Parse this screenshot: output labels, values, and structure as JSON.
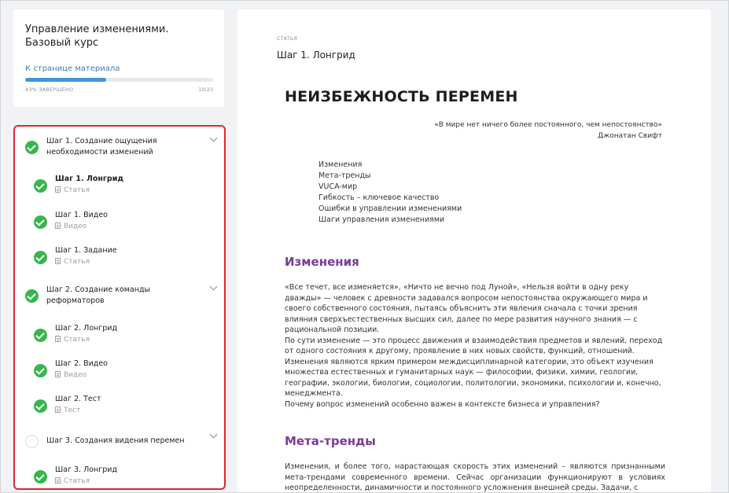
{
  "course": {
    "title": "Управление изменениями. Базовый курс",
    "link_label": "К странице материала",
    "progress_percent": 43,
    "progress_caption": "43% завершено",
    "progress_count": "10/23"
  },
  "nav": {
    "steps": [
      {
        "title": "Шаг 1. Создание ощущения необходимости изменений",
        "done": true,
        "items": [
          {
            "title": "Шаг 1. Лонгрид",
            "type": "Статья",
            "done": true,
            "active": true
          },
          {
            "title": "Шаг 1. Видео",
            "type": "Видео",
            "done": true
          },
          {
            "title": "Шаг 1. Задание",
            "type": "Статья",
            "done": true
          }
        ]
      },
      {
        "title": "Шаг 2.  Создание команды реформаторов",
        "done": true,
        "items": [
          {
            "title": "Шаг 2. Лонгрид",
            "type": "Статья",
            "done": true
          },
          {
            "title": "Шаг 2. Видео",
            "type": "Видео",
            "done": true
          },
          {
            "title": "Шаг 2. Тест",
            "type": "Тест",
            "done": true
          }
        ]
      },
      {
        "title": "Шаг 3.  Создания видения перемен",
        "done": false,
        "items": [
          {
            "title": "Шаг 3. Лонгрид",
            "type": "Статья",
            "done": true
          }
        ]
      }
    ]
  },
  "article": {
    "kicker": "Статья",
    "lesson_title": "Шаг 1. Лонгрид",
    "heading": "НЕИЗБЕЖНОСТЬ ПЕРЕМЕН",
    "epigraph_quote": "«В мире нет ничего более постоянного, чем непостоянство»",
    "epigraph_author": "Джонатан Свифт",
    "toc": [
      "Изменения",
      "Мета-тренды",
      "VUCA-мир",
      "Гибкость – ключевое качество",
      "Ошибки в управлении изменениями",
      "Шаги управления изменениями"
    ],
    "section1_title": "Изменения",
    "section1_paragraphs": [
      "«Все течет, все изменяется», «Ничто не вечно под Луной», «Нельзя войти в одну реку дважды» — человек с древности задавался вопросом непостоянства окружающего мира и своего собственного состояния, пытаясь объяснить эти явления сначала с точки зрения влияния сверхъестественных высших сил, далее по мере развития научного знания — с рациональной позиции.",
      "По сути изменение — это процесс движения и взаимодействия предметов и явлений, переход от одного состояния к другому, проявление в них новых свойств, функций, отношений.",
      "Изменения являются ярким примером междисциплинарной категории, это объект изучения множества естественных и гуманитарных наук — философии, физики, химии, геологии, географии, экологии, биологии, социологии, политологии, экономики, психологии и, конечно, менеджмента.",
      "Почему вопрос изменений особенно важен в контексте бизнеса и управления?"
    ],
    "section2_title": "Мета-тренды",
    "section2_paragraph": "Изменения, и более того, нарастающая скорость этих изменений – являются признанными мета-трендами современного времени. Сейчас организации функционируют в условиях неопределенности, динамичности и постоянного усложнения внешней среды. Задачи, с"
  },
  "colors": {
    "accent_purple": "#7b3a96",
    "check_green": "#36b74c",
    "progress_blue": "#3f95e0",
    "highlight_red": "#e0262f"
  }
}
